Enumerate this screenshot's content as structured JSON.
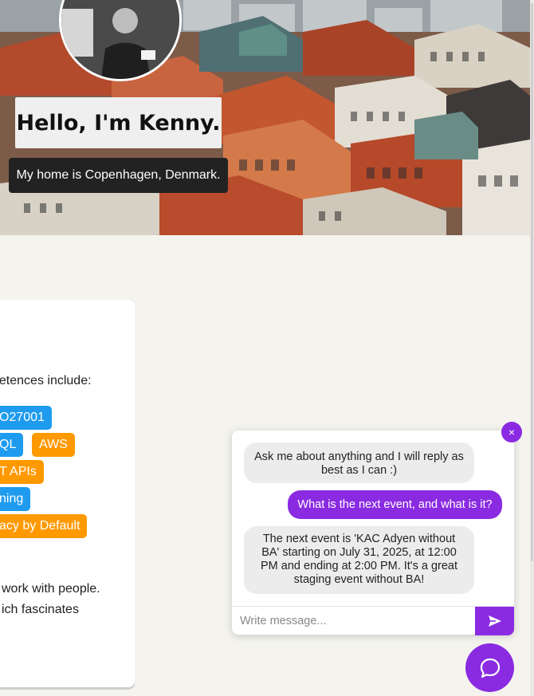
{
  "hero": {
    "title": "Hello, I'm Kenny.",
    "subtitle": "My home is Copenhagen, Denmark.",
    "avatar_icon": "profile-photo"
  },
  "card": {
    "intro": "petences include:",
    "chips": [
      {
        "label": "O27001",
        "color": "blue"
      },
      {
        "label": "QL",
        "color": "blue"
      },
      {
        "label": "AWS",
        "color": "orange"
      },
      {
        "label": "T APIs",
        "color": "orange"
      },
      {
        "label": "ning",
        "color": "blue"
      },
      {
        "label": "acy by Default",
        "color": "orange"
      }
    ],
    "text_line1": "work with people.",
    "text_line2": "ich fascinates"
  },
  "chat": {
    "close_label": "×",
    "messages": [
      {
        "from": "bot",
        "text": "Ask me about anything and I will reply as best as I can :)"
      },
      {
        "from": "user",
        "text": "What is the next event, and what is it?"
      },
      {
        "from": "bot",
        "text": "The next event is 'KAC Adyen without BA' starting on July 31, 2025, at 12:00 PM and ending at 2:00 PM. It's a great staging event without BA!"
      }
    ],
    "input_placeholder": "Write message...",
    "send_icon": "send-icon",
    "launcher_icon": "chat-bubble-icon"
  },
  "colors": {
    "accent": "#8a2be2",
    "chip_blue": "#1e9bef",
    "chip_orange": "#ff9900",
    "page_bg": "#f4f3ee"
  }
}
